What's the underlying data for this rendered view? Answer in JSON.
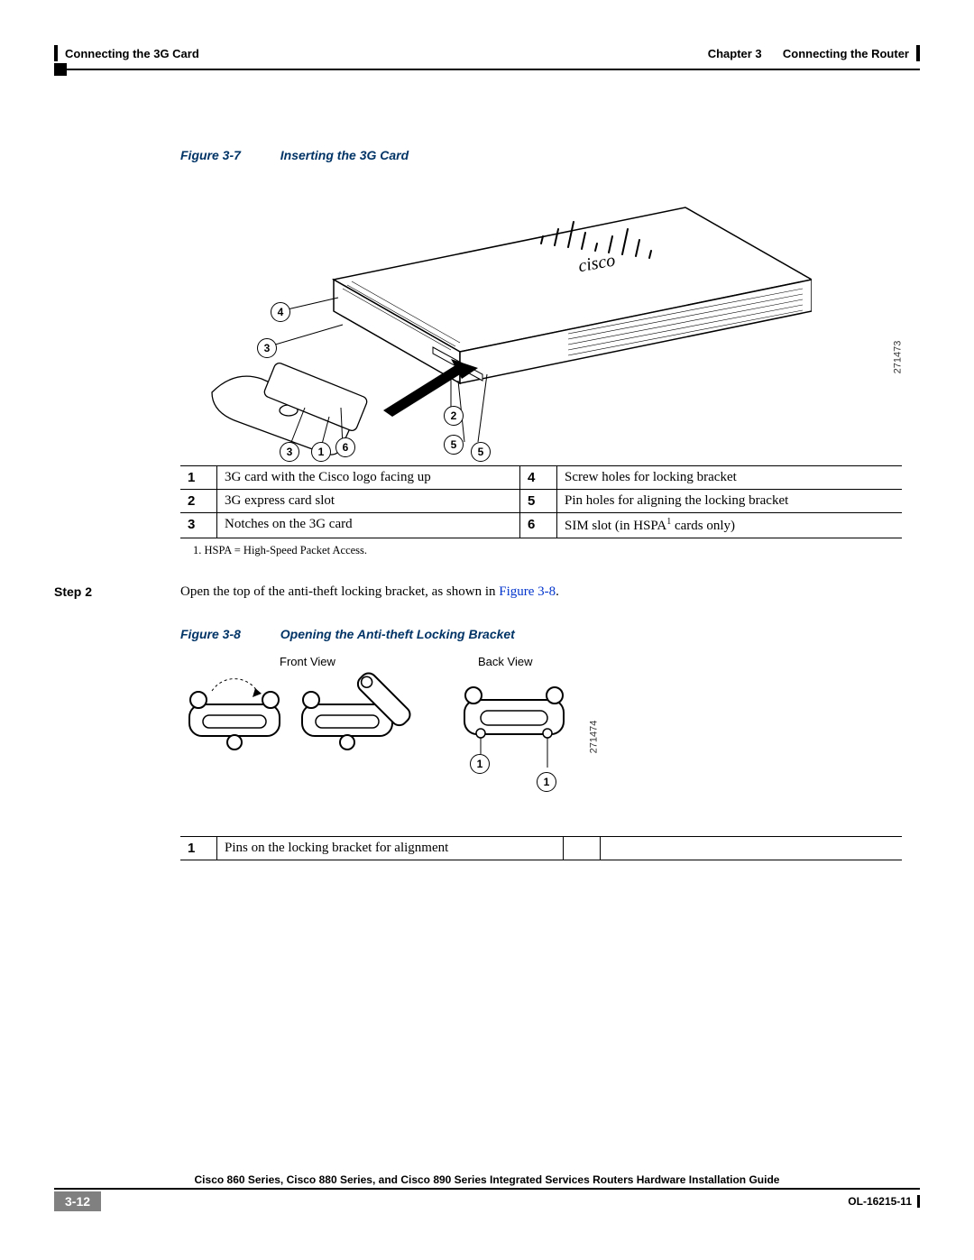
{
  "header": {
    "section": "Connecting the 3G Card",
    "chapter_label": "Chapter 3",
    "chapter_title": "Connecting the Router"
  },
  "figure7": {
    "label": "Figure 3-7",
    "title": "Inserting the 3G Card",
    "image_id": "271473",
    "callouts": [
      "1",
      "2",
      "3",
      "3",
      "4",
      "5",
      "5",
      "6"
    ],
    "legend": [
      {
        "n": "1",
        "d": "3G card with the Cisco logo facing up"
      },
      {
        "n": "2",
        "d": "3G express card slot"
      },
      {
        "n": "3",
        "d": "Notches on the 3G card"
      }
    ],
    "legend_r": [
      {
        "n": "4",
        "d": "Screw holes for locking bracket"
      },
      {
        "n": "5",
        "d": "Pin holes for aligning the locking bracket"
      },
      {
        "n": "6",
        "d": "SIM slot (in HSPA"
      }
    ],
    "legend_r_suffix": " cards only)",
    "footnote": "1.   HSPA = High-Speed Packet Access."
  },
  "step2": {
    "label": "Step 2",
    "text_before": "Open the top of the anti-theft locking bracket, as shown in ",
    "link": "Figure 3-8",
    "text_after": "."
  },
  "figure8": {
    "label": "Figure 3-8",
    "title": "Opening the Anti-theft Locking Bracket",
    "front": "Front View",
    "back": "Back View",
    "image_id": "271474",
    "legend": [
      {
        "n": "1",
        "d": "Pins on the locking bracket for alignment"
      }
    ]
  },
  "footer": {
    "title": "Cisco 860 Series, Cisco 880 Series, and Cisco 890 Series Integrated Services Routers Hardware Installation Guide",
    "page": "3-12",
    "docid": "OL-16215-11"
  }
}
